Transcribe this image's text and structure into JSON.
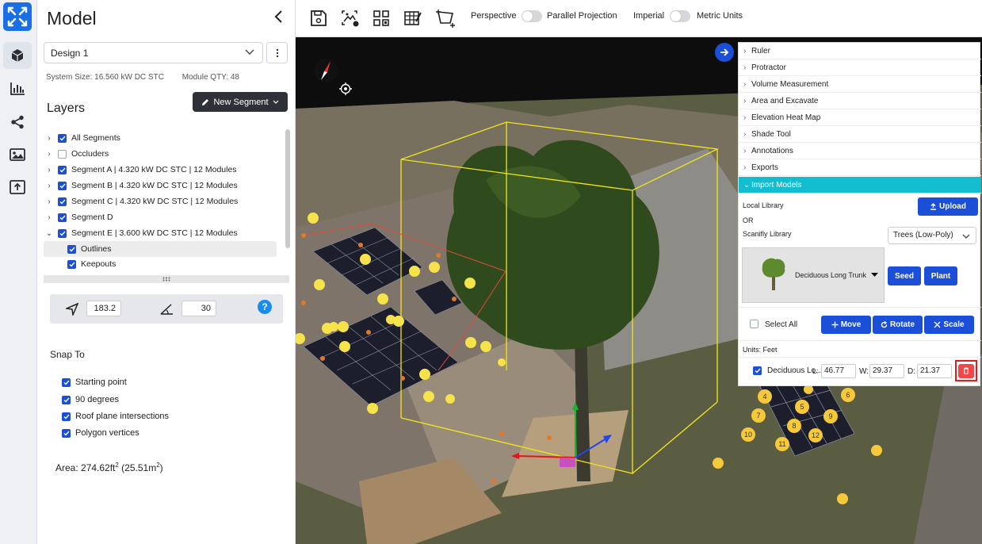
{
  "panel": {
    "title": "Model",
    "design": "Design 1",
    "system_size": "System Size: 16.560 kW DC STC",
    "module_qty": "Module QTY: 48",
    "layers_title": "Layers",
    "new_segment": "New Segment"
  },
  "layers": [
    {
      "label": "All Segments",
      "checked": true,
      "caret": "›"
    },
    {
      "label": "Occluders",
      "checked": false,
      "caret": "›"
    },
    {
      "label": "Segment A | 4.320 kW DC STC | 12 Modules",
      "checked": true,
      "caret": "›"
    },
    {
      "label": "Segment B | 4.320 kW DC STC | 12 Modules",
      "checked": true,
      "caret": "›"
    },
    {
      "label": "Segment C | 4.320 kW DC STC | 12 Modules",
      "checked": true,
      "caret": "›"
    },
    {
      "label": "Segment D",
      "checked": true,
      "caret": "›"
    },
    {
      "label": "Segment E | 3.600 kW DC STC | 12 Modules",
      "checked": true,
      "caret": "⌄"
    },
    {
      "label": "Outlines",
      "checked": true,
      "caret": ""
    },
    {
      "label": "Keepouts",
      "checked": true,
      "caret": ""
    }
  ],
  "angles": {
    "azimuth": "183.2",
    "pitch": "30",
    "help": "?"
  },
  "snap": {
    "title": "Snap To",
    "items": [
      "Starting point",
      "90 degrees",
      "Roof plane intersections",
      "Polygon vertices"
    ]
  },
  "area": {
    "prefix": "Area: 274.62ft",
    "sup1": "2",
    "middle": " (25.51m",
    "sup2": "2",
    "suffix": ")"
  },
  "toolbar": {
    "perspective": "Perspective",
    "parallel": "Parallel Projection",
    "imperial": "Imperial",
    "metric": "Metric Units"
  },
  "tools": {
    "items": [
      "Ruler",
      "Protractor",
      "Volume Measurement",
      "Area and Excavate",
      "Elevation Heat Map",
      "Shade Tool",
      "Annotations",
      "Exports"
    ],
    "active": "Import Models",
    "local_library": "Local Library",
    "or": "OR",
    "scanifly_library": "Scanifly Library",
    "upload": "Upload",
    "library_choice": "Trees (Low-Poly)",
    "model_name": "Deciduous Long Trunk",
    "seed": "Seed",
    "plant": "Plant",
    "select_all": "Select All",
    "move": "Move",
    "rotate": "Rotate",
    "scale": "Scale",
    "units": "Units: Feet",
    "row_name": "Deciduous Lo...",
    "l_label": "L:",
    "l_value": "46.77",
    "w_label": "W:",
    "w_value": "29.37",
    "d_label": "D:",
    "d_value": "21.37"
  },
  "panel_numbers": [
    "4",
    "5",
    "6",
    "7",
    "8",
    "9",
    "10",
    "11",
    "12"
  ],
  "colors": {
    "accent": "#1b4fd8",
    "active_tool": "#12bdd0",
    "delete": "#e01e1e",
    "arrow": "#f03a23"
  }
}
